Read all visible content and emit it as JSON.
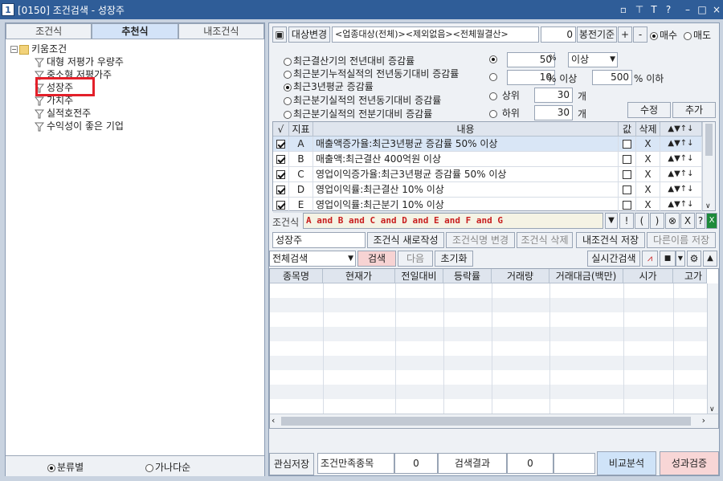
{
  "window": {
    "icon": "1",
    "title": "[0150] 조건검색 - 성장주",
    "buttons": [
      "restore-icon",
      "pin-icon",
      "font-icon",
      "help-icon",
      "minimize-icon",
      "maximize-icon",
      "close-icon"
    ]
  },
  "left": {
    "tabs": [
      "조건식",
      "추천식",
      "내조건식"
    ],
    "active_tab": "추천식",
    "tree": {
      "root": "키움조건",
      "items": [
        "대형 저평가 우량주",
        "중소형 저평가주",
        "성장주",
        "가치주",
        "실적호전주",
        "수익성이 좋은 기업"
      ],
      "selected": "성장주"
    },
    "bottom": {
      "opt1": "분류별",
      "opt2": "가나다순"
    }
  },
  "right": {
    "top": {
      "target_btn": "대상변경",
      "target_text": "<업종대상(전체)><제외없음><전체월결산>",
      "num": "0",
      "basis_btn": "봉전기준",
      "plus": "+",
      "minus": "-",
      "buy": "매수",
      "sell": "매도"
    },
    "options": [
      "최근결산기의 전년대비 증감률",
      "최근분기누적실적의 전년동기대비 증감률",
      "최근3년평균 증감률",
      "최근분기실적의 전년동기대비 증감률",
      "최근분기실적의 전분기대비 증감률"
    ],
    "selected_option": "최근3년평균 증감률",
    "params": {
      "v1": "50",
      "unit1": "%",
      "sel1": "이상",
      "v2": "10",
      "unit2": "% 이상",
      "v3": "500",
      "unit3": "% 이하",
      "top_lbl": "상위",
      "top_val": "30",
      "top_unit": "개",
      "bot_lbl": "하위",
      "bot_val": "30",
      "bot_unit": "개",
      "edit_btn": "수정",
      "add_btn": "추가"
    },
    "cond_table": {
      "headers": [
        "√",
        "지표",
        "내용",
        "값",
        "삭제"
      ],
      "rows": [
        {
          "checked": true,
          "id": "A",
          "content": "매출액증가율:최근3년평균 증감률 50% 이상",
          "del": "X"
        },
        {
          "checked": true,
          "id": "B",
          "content": "매출액:최근결산 400억원 이상",
          "del": "X"
        },
        {
          "checked": true,
          "id": "C",
          "content": "영업이익증가율:최근3년평균 증감률 50% 이상",
          "del": "X"
        },
        {
          "checked": true,
          "id": "D",
          "content": "영업이익률:최근결산 10% 이상",
          "del": "X"
        },
        {
          "checked": true,
          "id": "E",
          "content": "영업이익률:최근분기 10% 이상",
          "del": "X"
        }
      ]
    },
    "formula": {
      "label": "조건식",
      "value": "A and B and C and D and E and F and G",
      "buttons": [
        "!",
        "(",
        ")",
        "⊗",
        "X",
        "?"
      ]
    },
    "name_row": {
      "name": "성장주",
      "new_btn": "조건식 새로작성",
      "rename_btn": "조건식명 변경",
      "delete_btn": "조건식 삭제",
      "save_btn": "내조건식 저장",
      "saveas_btn": "다른이름 저장"
    },
    "search_row": {
      "mode": "전체검색",
      "search": "검색",
      "next": "다음",
      "reset": "초기화",
      "realtime": "실시간검색"
    },
    "result_headers": [
      "종목명",
      "현재가",
      "전일대비",
      "등락률",
      "거래량",
      "거래대금(백만)",
      "시가",
      "고가"
    ],
    "bottom": {
      "fav": "관심저장",
      "cond_count_lbl": "조건만족종목",
      "cond_count": "0",
      "result_lbl": "검색결과",
      "result": "0",
      "compare": "비교분석",
      "verify": "성과검증"
    }
  },
  "colors": {
    "titlebar": "#2f5d98",
    "accent_red": "#e3202a",
    "search_btn": "#f7d3d3",
    "compare_btn": "#cfe3f8",
    "verify_btn": "#f8d6d6"
  }
}
